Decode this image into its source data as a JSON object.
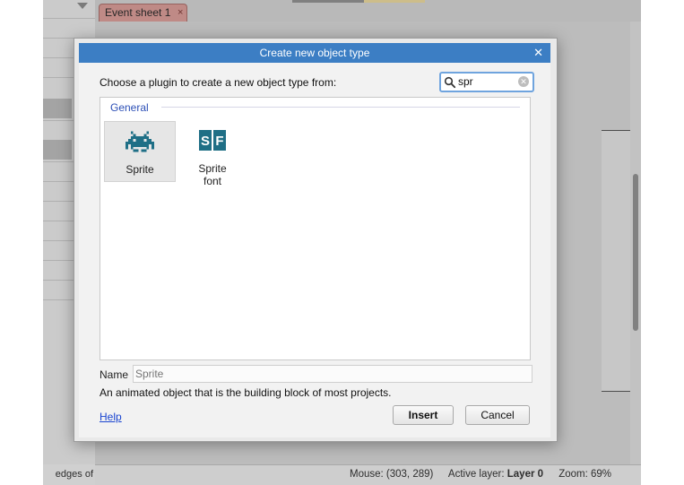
{
  "background": {
    "tab": {
      "label": "Event sheet 1",
      "close_glyph": "×",
      "color": "#d59a96"
    },
    "left_panel_footer": "edges of",
    "status": {
      "mouse": "Mouse: (303, 289)",
      "active_layer_label": "Active layer:",
      "active_layer_value": "Layer 0",
      "zoom": "Zoom: 69%"
    }
  },
  "dialog": {
    "title": "Create new object type",
    "close_glyph": "✕",
    "prompt": "Choose a plugin to create a new object type from:",
    "search": {
      "value": "spr",
      "icon": "search-icon",
      "clear_glyph": "✕"
    },
    "group": "General",
    "plugins": [
      {
        "label": "Sprite",
        "icon": "space-invader-icon",
        "selected": true
      },
      {
        "label": "Sprite\nfont",
        "icon": "sprite-font-icon",
        "icon_text": [
          "S",
          "F"
        ],
        "selected": false
      }
    ],
    "name_label": "Name",
    "name_placeholder": "Sprite",
    "description": "An animated object that is the building block of most projects.",
    "help": "Help",
    "insert": "Insert",
    "cancel": "Cancel",
    "accent": "#3c7ec4",
    "icon_color": "#1f6f86"
  }
}
